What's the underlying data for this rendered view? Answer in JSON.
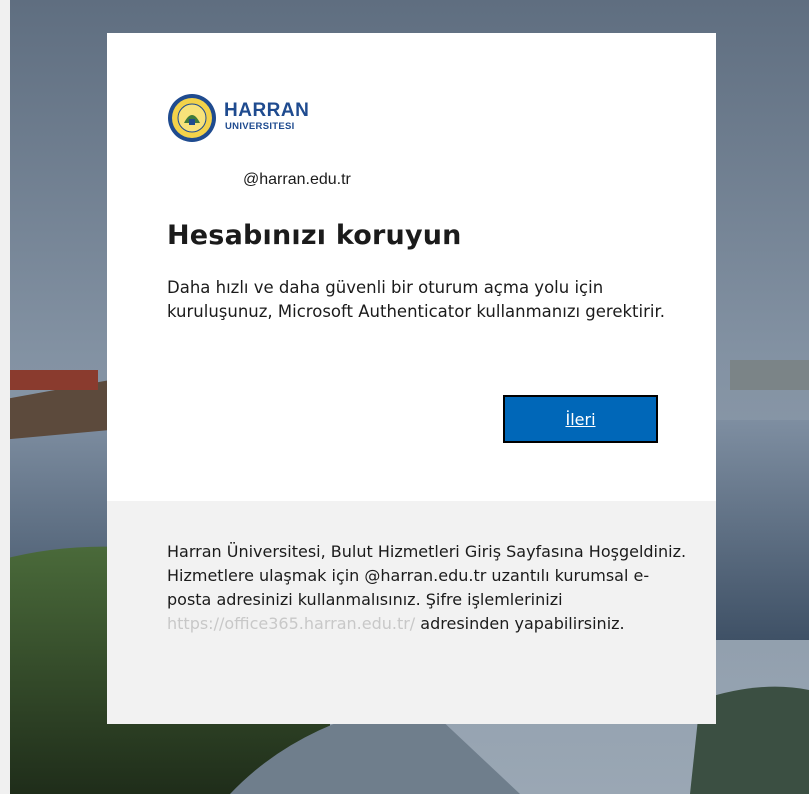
{
  "logo": {
    "name_line1": "HARRAN",
    "name_line2": "UNIVERSITESI",
    "seal_icon": "university-seal-icon"
  },
  "identity": "@harran.edu.tr",
  "title": "Hesabınızı koruyun",
  "description": "Daha hızlı ve daha güvenli bir oturum açma yolu için kuruluşunuz, Microsoft Authenticator kullanmanızı gerektirir.",
  "next_button": "İleri",
  "footer": {
    "text_before_link": "Harran Üniversitesi, Bulut Hizmetleri Giriş Sayfasına Hoşgeldiniz. Hizmetlere ulaşmak için @harran.edu.tr uzantılı kurumsal e-posta adresinizi kullanmalısınız. Şifre işlemlerinizi ",
    "link": "https://office365.harran.edu.tr/",
    "text_after_link": " adresinden yapabilirsiniz."
  },
  "colors": {
    "button": "#0067b8",
    "brand": "#1f4b8f",
    "footer_bg": "#f2f2f2"
  }
}
